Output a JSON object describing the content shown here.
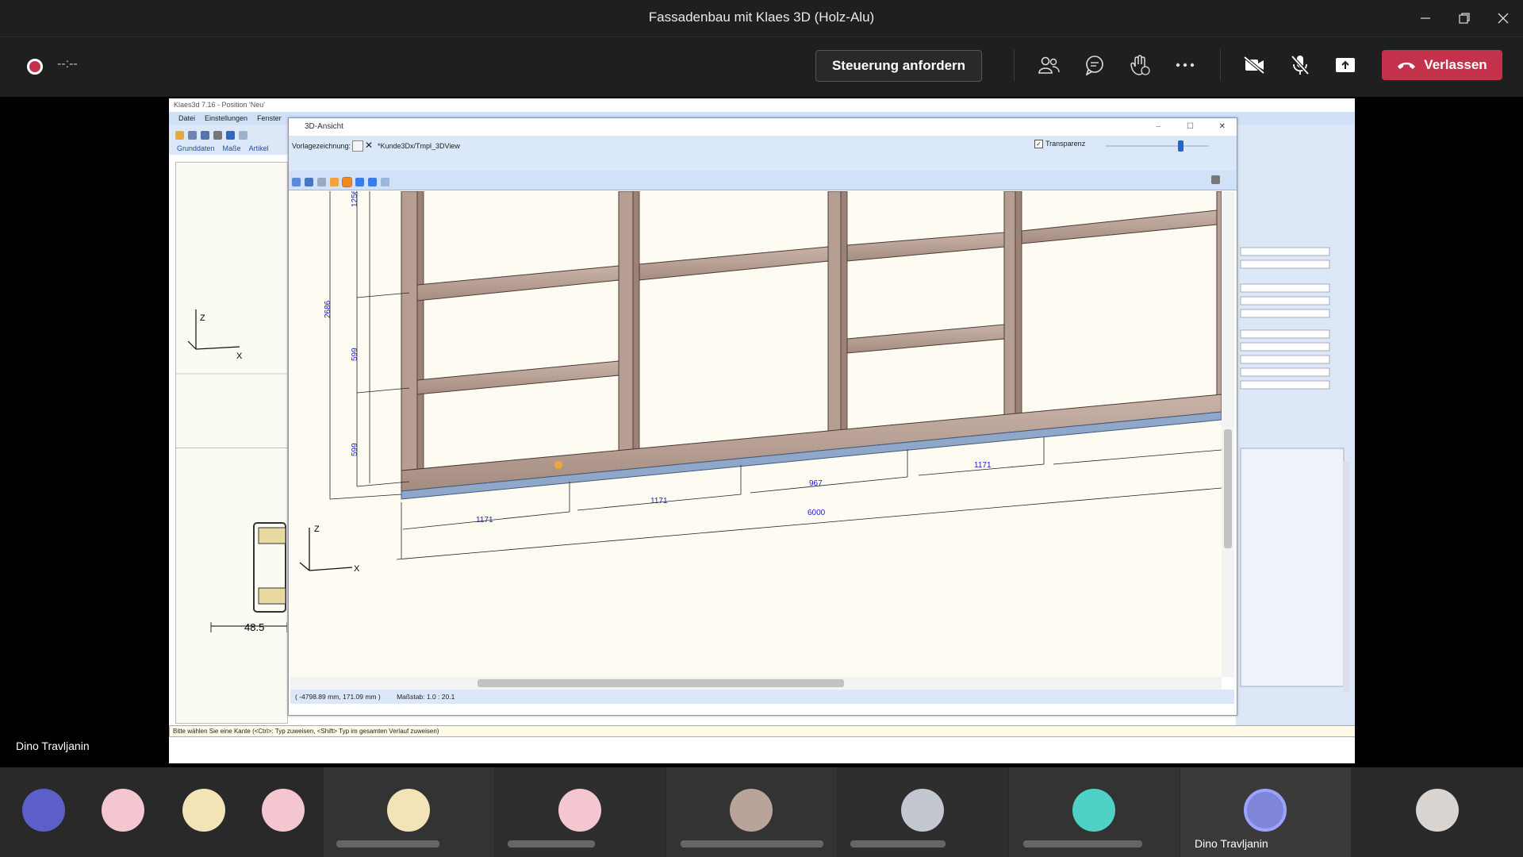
{
  "window": {
    "title": "Fassadenbau mit Klaes 3D (Holz-Alu)"
  },
  "toolbar": {
    "recording_time": "--:--",
    "request_control_label": "Steuerung anfordern",
    "leave_label": "Verlassen",
    "leave_color": "#c4314b"
  },
  "presenter_name": "Dino Travljanin",
  "participants": {
    "active_speaker_name": "Dino Travljanin"
  },
  "cad": {
    "app_title": "Klaes3d 7.16 - Position 'Neu'",
    "menu": [
      "Datei",
      "Einstellungen",
      "Fenster"
    ],
    "tabs": [
      "Grunddaten",
      "Maße",
      "Artikel"
    ],
    "left_dims": {
      "label": "48.5"
    },
    "axis": {
      "z": "Z",
      "x": "X"
    },
    "status_text": "Bitte wählen Sie eine Kante (<Ctrl>: Typ zuweisen, <Shift> Typ im gesamten Verlauf zuweisen)",
    "dialog": {
      "title": "3D-Ansicht",
      "vorlage_label": "Vorlagezeichnung:",
      "vorlage_path": "*Kunde3Dx/Tmpl_3DView",
      "transparency_label": "Transparenz",
      "coords": "( -4798.89 mm, 171.09 mm )",
      "scale": "Maßstab: 1.0 : 20.1",
      "dimensions": {
        "v1": "1256",
        "v2": "2686",
        "v3": "599",
        "v4": "599",
        "h1": "1171",
        "h2": "1171",
        "h3": "967",
        "h4": "1171",
        "total": "6000"
      }
    }
  }
}
